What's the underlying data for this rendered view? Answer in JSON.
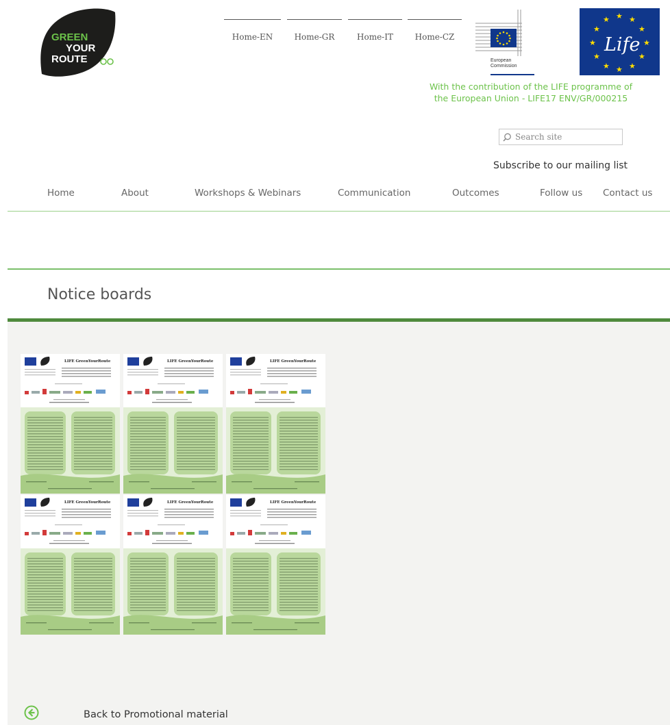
{
  "brand": {
    "logo_lines": [
      "GREEN",
      "YOUR",
      "ROUTE"
    ],
    "colors": {
      "green": "#6cc24a",
      "dark_green": "#4f8a3d",
      "eu_blue": "#10378b",
      "star_yellow": "#ffdd00"
    }
  },
  "language_links": [
    {
      "label": "Home-EN"
    },
    {
      "label": "Home-GR"
    },
    {
      "label": "Home-IT"
    },
    {
      "label": "Home-CZ"
    }
  ],
  "partners": {
    "ec_logo_text": [
      "European",
      "Commission"
    ],
    "life_logo_text": "Life"
  },
  "contribution": {
    "line1": "With the contribution of the LIFE programme of",
    "line2": "the European Union - LIFE17 ENV/GR/000215"
  },
  "search": {
    "placeholder": "Search site",
    "icon": "search-icon"
  },
  "subscribe_label": "Subscribe to our mailing list",
  "nav": {
    "home": "Home",
    "about": "About",
    "workshops": "Workshops & Webinars",
    "communication": "Communication",
    "outcomes": "Outcomes",
    "follow": "Follow us",
    "contact": "Contact us"
  },
  "page_title": "Notice boards",
  "gallery": {
    "thumbnail_heading": "LIFE GreenYourRoute",
    "items": 6
  },
  "back_link": {
    "label": "Back to Promotional material",
    "icon": "arrow-left-circle-icon"
  }
}
